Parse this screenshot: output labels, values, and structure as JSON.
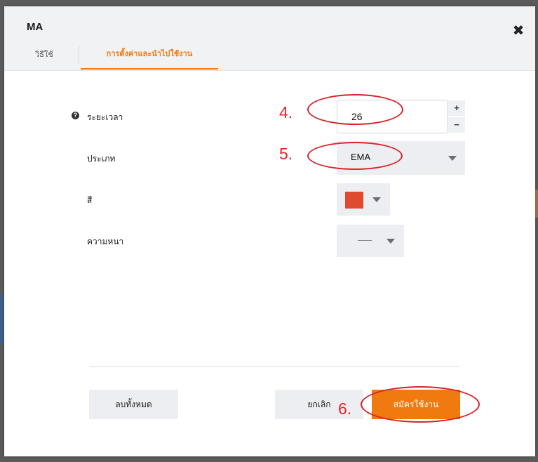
{
  "modal": {
    "title": "MA",
    "close_icon": "close-icon",
    "tabs": [
      {
        "label": "วิธีใช้",
        "active": false
      },
      {
        "label": "การตั้งค่าและนำไปใช้งาน",
        "active": true
      }
    ]
  },
  "form": {
    "period": {
      "label": "ระยะเวลา",
      "value": "26",
      "help_icon": "question-circle-icon"
    },
    "type": {
      "label": "ประเภท",
      "value": "EMA"
    },
    "color": {
      "label": "สี",
      "value": "#e04a2f"
    },
    "thickness": {
      "label": "ความหนา",
      "value_glyph": "—"
    }
  },
  "buttons": {
    "clear_all": "ลบทั้งหมด",
    "cancel": "ยกเลิก",
    "apply": "สมัครใช้งาน"
  },
  "annotations": {
    "step4": "4.",
    "step5": "5.",
    "step6": "6."
  },
  "colors": {
    "accent": "#f07a0f",
    "annotation": "#e8232a",
    "header_bg": "#f1f2f4",
    "control_bg": "#eceef1"
  }
}
